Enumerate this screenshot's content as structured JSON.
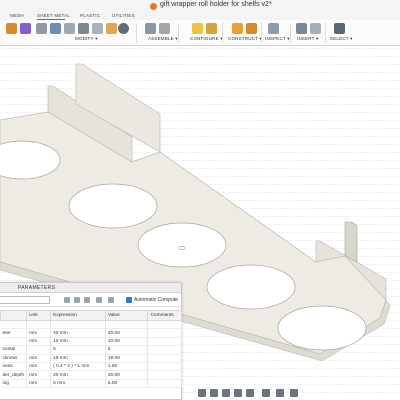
{
  "window": {
    "title": "gift wrapper roll holder for shelfs v2*"
  },
  "workspace_tabs": [
    "MESH",
    "SHEET METAL",
    "PLASTIC",
    "UTILITIES"
  ],
  "toolbar": {
    "groups": [
      "MODIFY ▾",
      "ASSEMBLE ▾",
      "CONFIGURE ▾",
      "CONSTRUCT ▾",
      "INSPECT ▾",
      "INSERT ▾",
      "SELECT ▾"
    ]
  },
  "parameters": {
    "title": "PARAMETERS",
    "search": {
      "value": "",
      "placeholder": ""
    },
    "auto_compute_label": "Automatic Compute",
    "auto_compute_checked": true,
    "columns": [
      "",
      "Unit",
      "Expression",
      "Value",
      "Comments"
    ],
    "rows": [
      [
        "",
        "",
        "",
        "",
        ""
      ],
      [
        "eter",
        "mm",
        "40 mm",
        "40.00",
        ""
      ],
      [
        "",
        "mm",
        "10 mm",
        "10.00",
        ""
      ],
      [
        "zontal",
        "",
        "5",
        "5",
        ""
      ],
      [
        "ckness",
        "mm",
        "19 mm",
        "19.00",
        ""
      ],
      [
        "ness",
        "mm",
        "( 0.4 * 4 ) * 1 mm",
        "1.60",
        ""
      ],
      [
        "der_depth",
        "mm",
        "20 mm",
        "20.00",
        ""
      ],
      [
        "ing",
        "mm",
        "5 mm",
        "5.00",
        ""
      ]
    ]
  }
}
